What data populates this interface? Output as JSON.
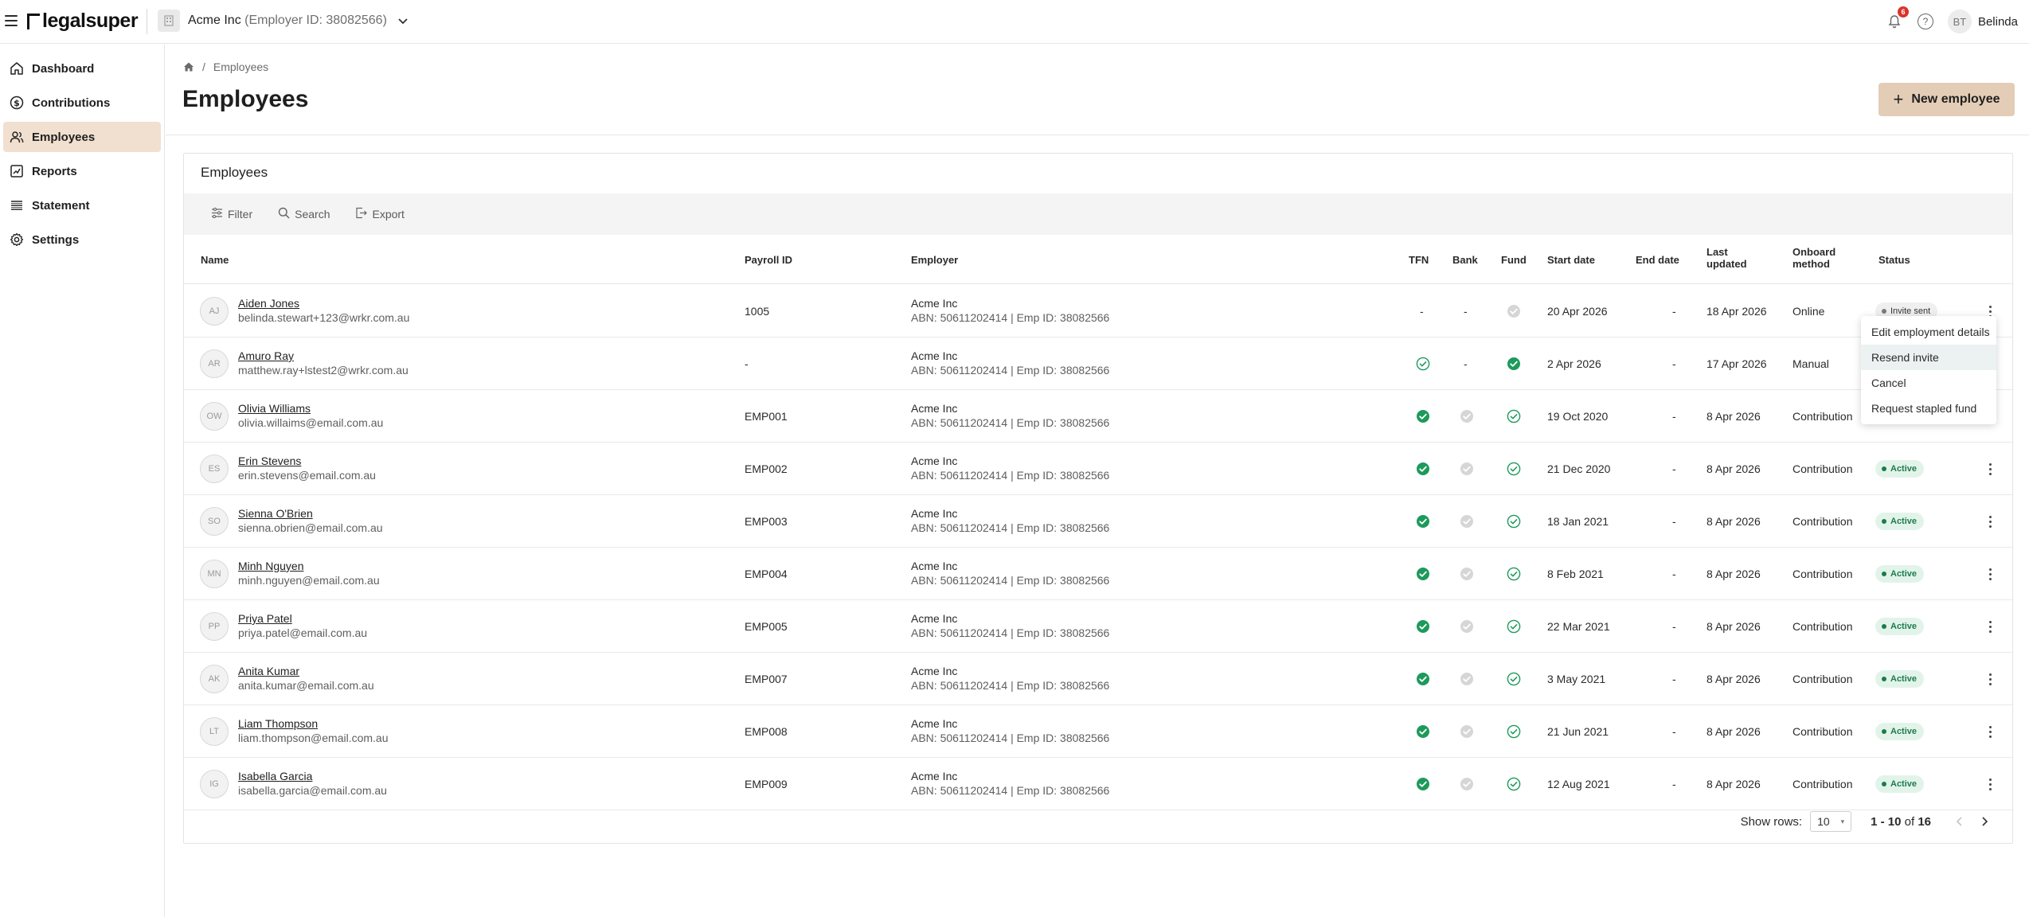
{
  "brand": {
    "logo_text": "legalsuper"
  },
  "header": {
    "employer_name": "Acme Inc",
    "employer_id": "(Employer ID: 38082566)",
    "notification_count": "6",
    "user_initials": "BT",
    "user_name": "Belinda"
  },
  "sidebar": {
    "items": [
      {
        "label": "Dashboard",
        "icon": "home-icon"
      },
      {
        "label": "Contributions",
        "icon": "dollar-icon"
      },
      {
        "label": "Employees",
        "icon": "users-icon",
        "active": true
      },
      {
        "label": "Reports",
        "icon": "chart-icon"
      },
      {
        "label": "Statement",
        "icon": "list-icon"
      },
      {
        "label": "Settings",
        "icon": "gear-icon"
      }
    ]
  },
  "page": {
    "breadcrumb_sep": "/",
    "breadcrumb": "Employees",
    "title": "Employees",
    "new_button": "New employee"
  },
  "card": {
    "title": "Employees",
    "toolbar": {
      "filter": "Filter",
      "search": "Search",
      "export": "Export"
    },
    "columns": {
      "name": "Name",
      "payroll_id": "Payroll ID",
      "employer": "Employer",
      "tfn": "TFN",
      "bank": "Bank",
      "fund": "Fund",
      "start_date": "Start date",
      "end_date": "End date",
      "last_updated_1": "Last",
      "last_updated_2": "updated",
      "onboard_1": "Onboard",
      "onboard_2": "method",
      "status": "Status"
    },
    "rows": [
      {
        "initials": "AJ",
        "name": "Aiden Jones",
        "email": "belinda.stewart+123@wrkr.com.au",
        "payroll_id": "1005",
        "employer": "Acme Inc",
        "employer_detail": "ABN: 50611202414 | Emp ID: 38082566",
        "tfn": "-",
        "bank": "-",
        "fund": "grey",
        "start_date": "20 Apr 2026",
        "end_date": "-",
        "last_updated": "18 Apr 2026",
        "onboard": "Online",
        "status": "Invite sent"
      },
      {
        "initials": "AR",
        "name": "Amuro Ray",
        "email": "matthew.ray+lstest2@wrkr.com.au",
        "payroll_id": "-",
        "employer": "Acme Inc",
        "employer_detail": "ABN: 50611202414 | Emp ID: 38082566",
        "tfn": "outline",
        "bank": "-",
        "fund": "solid",
        "start_date": "2 Apr 2026",
        "end_date": "-",
        "last_updated": "17 Apr 2026",
        "onboard": "Manual",
        "status": ""
      },
      {
        "initials": "OW",
        "name": "Olivia Williams",
        "email": "olivia.willaims@email.com.au",
        "payroll_id": "EMP001",
        "employer": "Acme Inc",
        "employer_detail": "ABN: 50611202414 | Emp ID: 38082566",
        "tfn": "solid",
        "bank": "grey",
        "fund": "outline",
        "start_date": "19 Oct 2020",
        "end_date": "-",
        "last_updated": "8 Apr 2026",
        "onboard": "Contribution",
        "status": ""
      },
      {
        "initials": "ES",
        "name": "Erin Stevens",
        "email": "erin.stevens@email.com.au",
        "payroll_id": "EMP002",
        "employer": "Acme Inc",
        "employer_detail": "ABN: 50611202414 | Emp ID: 38082566",
        "tfn": "solid",
        "bank": "grey",
        "fund": "outline",
        "start_date": "21 Dec 2020",
        "end_date": "-",
        "last_updated": "8 Apr 2026",
        "onboard": "Contribution",
        "status": "Active"
      },
      {
        "initials": "SO",
        "name": "Sienna O'Brien",
        "email": "sienna.obrien@email.com.au",
        "payroll_id": "EMP003",
        "employer": "Acme Inc",
        "employer_detail": "ABN: 50611202414 | Emp ID: 38082566",
        "tfn": "solid",
        "bank": "grey",
        "fund": "outline",
        "start_date": "18 Jan 2021",
        "end_date": "-",
        "last_updated": "8 Apr 2026",
        "onboard": "Contribution",
        "status": "Active"
      },
      {
        "initials": "MN",
        "name": "Minh Nguyen",
        "email": "minh.nguyen@email.com.au",
        "payroll_id": "EMP004",
        "employer": "Acme Inc",
        "employer_detail": "ABN: 50611202414 | Emp ID: 38082566",
        "tfn": "solid",
        "bank": "grey",
        "fund": "outline",
        "start_date": "8 Feb 2021",
        "end_date": "-",
        "last_updated": "8 Apr 2026",
        "onboard": "Contribution",
        "status": "Active"
      },
      {
        "initials": "PP",
        "name": "Priya Patel",
        "email": "priya.patel@email.com.au",
        "payroll_id": "EMP005",
        "employer": "Acme Inc",
        "employer_detail": "ABN: 50611202414 | Emp ID: 38082566",
        "tfn": "solid",
        "bank": "grey",
        "fund": "outline",
        "start_date": "22 Mar 2021",
        "end_date": "-",
        "last_updated": "8 Apr 2026",
        "onboard": "Contribution",
        "status": "Active"
      },
      {
        "initials": "AK",
        "name": "Anita Kumar",
        "email": "anita.kumar@email.com.au",
        "payroll_id": "EMP007",
        "employer": "Acme Inc",
        "employer_detail": "ABN: 50611202414 | Emp ID: 38082566",
        "tfn": "solid",
        "bank": "grey",
        "fund": "outline",
        "start_date": "3 May 2021",
        "end_date": "-",
        "last_updated": "8 Apr 2026",
        "onboard": "Contribution",
        "status": "Active"
      },
      {
        "initials": "LT",
        "name": "Liam Thompson",
        "email": "liam.thompson@email.com.au",
        "payroll_id": "EMP008",
        "employer": "Acme Inc",
        "employer_detail": "ABN: 50611202414 | Emp ID: 38082566",
        "tfn": "solid",
        "bank": "grey",
        "fund": "outline",
        "start_date": "21 Jun 2021",
        "end_date": "-",
        "last_updated": "8 Apr 2026",
        "onboard": "Contribution",
        "status": "Active"
      },
      {
        "initials": "IG",
        "name": "Isabella Garcia",
        "email": "isabella.garcia@email.com.au",
        "payroll_id": "EMP009",
        "employer": "Acme Inc",
        "employer_detail": "ABN: 50611202414 | Emp ID: 38082566",
        "tfn": "solid",
        "bank": "grey",
        "fund": "outline",
        "start_date": "12 Aug 2021",
        "end_date": "-",
        "last_updated": "8 Apr 2026",
        "onboard": "Contribution",
        "status": "Active"
      }
    ],
    "pagination": {
      "show_rows_label": "Show rows:",
      "rows_value": "10",
      "range": "1 - 10",
      "of": "of",
      "total": "16"
    }
  },
  "row_menu": {
    "items": [
      "Edit employment details",
      "Resend invite",
      "Cancel",
      "Request stapled fund"
    ],
    "highlighted": "Resend invite"
  },
  "colors": {
    "accent_button": "#e4cdb6",
    "active_nav": "#f1e0cf",
    "status_active": "#1d7b4b",
    "check_green": "#1d9a5b",
    "notification": "#d9342b"
  }
}
